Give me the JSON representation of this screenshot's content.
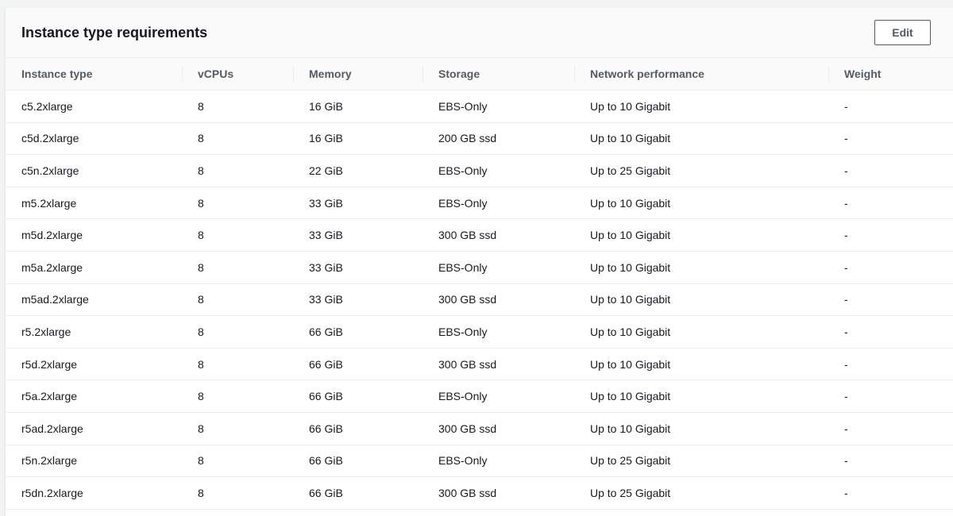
{
  "panel": {
    "title": "Instance type requirements",
    "edit_label": "Edit"
  },
  "table": {
    "columns": [
      "Instance type",
      "vCPUs",
      "Memory",
      "Storage",
      "Network performance",
      "Weight"
    ],
    "rows": [
      [
        "c5.2xlarge",
        "8",
        "16 GiB",
        "EBS-Only",
        "Up to 10 Gigabit",
        "-"
      ],
      [
        "c5d.2xlarge",
        "8",
        "16 GiB",
        "200 GB ssd",
        "Up to 10 Gigabit",
        "-"
      ],
      [
        "c5n.2xlarge",
        "8",
        "22 GiB",
        "EBS-Only",
        "Up to 25 Gigabit",
        "-"
      ],
      [
        "m5.2xlarge",
        "8",
        "33 GiB",
        "EBS-Only",
        "Up to 10 Gigabit",
        "-"
      ],
      [
        "m5d.2xlarge",
        "8",
        "33 GiB",
        "300 GB ssd",
        "Up to 10 Gigabit",
        "-"
      ],
      [
        "m5a.2xlarge",
        "8",
        "33 GiB",
        "EBS-Only",
        "Up to 10 Gigabit",
        "-"
      ],
      [
        "m5ad.2xlarge",
        "8",
        "33 GiB",
        "300 GB ssd",
        "Up to 10 Gigabit",
        "-"
      ],
      [
        "r5.2xlarge",
        "8",
        "66 GiB",
        "EBS-Only",
        "Up to 10 Gigabit",
        "-"
      ],
      [
        "r5d.2xlarge",
        "8",
        "66 GiB",
        "300 GB ssd",
        "Up to 10 Gigabit",
        "-"
      ],
      [
        "r5a.2xlarge",
        "8",
        "66 GiB",
        "EBS-Only",
        "Up to 10 Gigabit",
        "-"
      ],
      [
        "r5ad.2xlarge",
        "8",
        "66 GiB",
        "300 GB ssd",
        "Up to 10 Gigabit",
        "-"
      ],
      [
        "r5n.2xlarge",
        "8",
        "66 GiB",
        "EBS-Only",
        "Up to 25 Gigabit",
        "-"
      ],
      [
        "r5dn.2xlarge",
        "8",
        "66 GiB",
        "300 GB ssd",
        "Up to 25 Gigabit",
        "-"
      ]
    ]
  }
}
